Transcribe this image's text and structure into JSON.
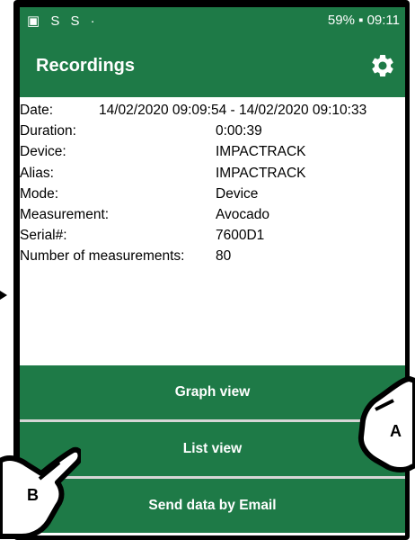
{
  "status_bar": {
    "left_icons": "▣ S S ·",
    "right_text": "59% ▪ 09:11"
  },
  "app_bar": {
    "title": "Recordings",
    "settings_icon": "gear-icon"
  },
  "details": [
    {
      "label": "Date:",
      "value": "14/02/2020 09:09:54 - 14/02/2020 09:10:33"
    },
    {
      "label": "Duration:",
      "value": "0:00:39"
    },
    {
      "label": "Device:",
      "value": "IMPACTRACK"
    },
    {
      "label": "Alias:",
      "value": "IMPACTRACK"
    },
    {
      "label": "Mode:",
      "value": "Device"
    },
    {
      "label": "Measurement:",
      "value": "Avocado"
    },
    {
      "label": "Serial#:",
      "value": "7600D1"
    },
    {
      "label": "Number of measurements:",
      "value": "80"
    }
  ],
  "buttons": {
    "graph_view": "Graph view",
    "list_view": "List view",
    "send_email": "Send data by Email"
  },
  "annotations": {
    "a": "A",
    "b": "B"
  },
  "colors": {
    "primary": "#1e7a47"
  }
}
